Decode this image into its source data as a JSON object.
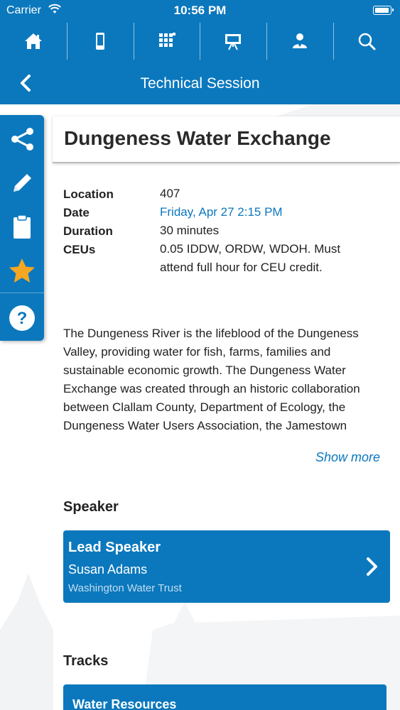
{
  "status_bar": {
    "carrier": "Carrier",
    "time": "10:56 PM"
  },
  "nav": {
    "icons": [
      "home-icon",
      "mobile-device-icon",
      "grid-icon",
      "presentation-icon",
      "attendee-icon",
      "search-icon"
    ]
  },
  "header": {
    "title": "Technical Session",
    "back_icon": "chevron-left-icon"
  },
  "side_toolbar": {
    "icons": [
      "share-icon",
      "pencil-icon",
      "clipboard-icon",
      "star-icon",
      "help-icon"
    ]
  },
  "session": {
    "title": "Dungeness Water Exchange",
    "details": {
      "location_label": "Location",
      "location_value": "407",
      "date_label": "Date",
      "date_value": "Friday, Apr 27 2:15 PM",
      "duration_label": "Duration",
      "duration_value": "30 minutes",
      "ceus_label": "CEUs",
      "ceus_value": "0.05 IDDW, ORDW, WDOH.  Must attend full hour for CEU credit."
    },
    "description": "The Dungeness River is the lifeblood of the Dungeness Valley, providing water for fish, farms, families and sustainable economic growth. The Dungeness Water Exchange was created through an historic collaboration between Clallam County, Department of Ecology, the Dungeness Water Users Association, the Jamestown S'Klallam Tribe, City of",
    "show_more": "Show more"
  },
  "speaker_section": {
    "heading": "Speaker",
    "role": "Lead Speaker",
    "name": "Susan Adams",
    "organization": "Washington Water Trust"
  },
  "tracks_section": {
    "heading": "Tracks",
    "track": "Water Resources"
  },
  "colors": {
    "primary": "#0b78bd",
    "accent_star": "#f5a623",
    "text": "#222222"
  }
}
